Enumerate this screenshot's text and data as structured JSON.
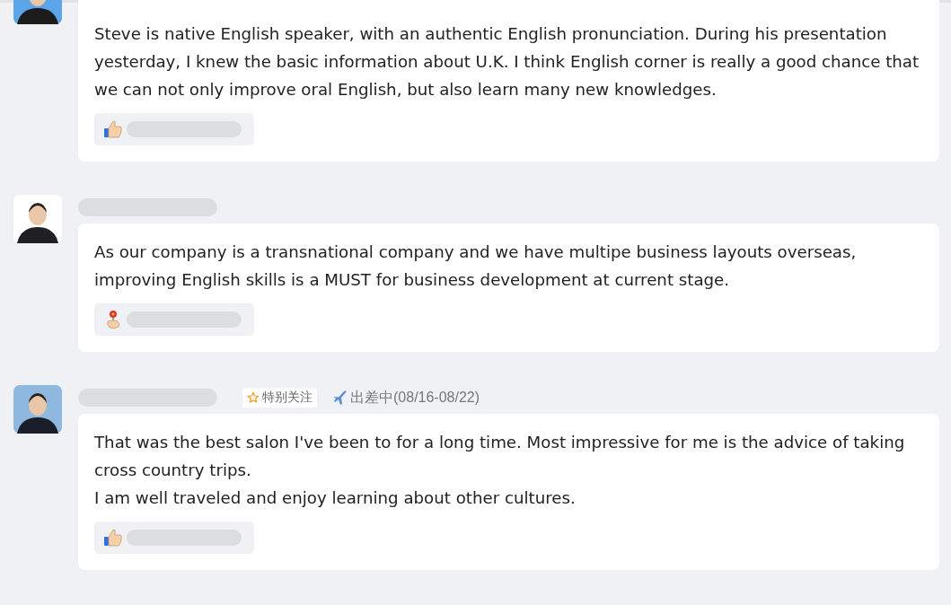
{
  "messages": [
    {
      "name_blurred": false,
      "text": "Steve is native English speaker, with an authentic English pronunciation.  During his presentation yesterday, I knew the basic information about U.K.  I think English corner is really a good chance that we can not only improve oral English, but also learn many new knowledges.",
      "reaction": {
        "kind": "thumbs_up"
      }
    },
    {
      "name_blurred": true,
      "text": "As our company is a transnational company and we have multipe business layouts overseas, improving English skills is a MUST for business development at current stage.",
      "reaction": {
        "kind": "flower"
      }
    },
    {
      "name_blurred": true,
      "badge": "特别关注",
      "status": "出差中(08/16-08/22)",
      "text": "That was the best salon I've been to for a long time. Most impressive for me is the advice of taking cross country trips.\nI am well traveled and enjoy learning about other cultures.",
      "reaction": {
        "kind": "thumbs_up"
      }
    }
  ]
}
